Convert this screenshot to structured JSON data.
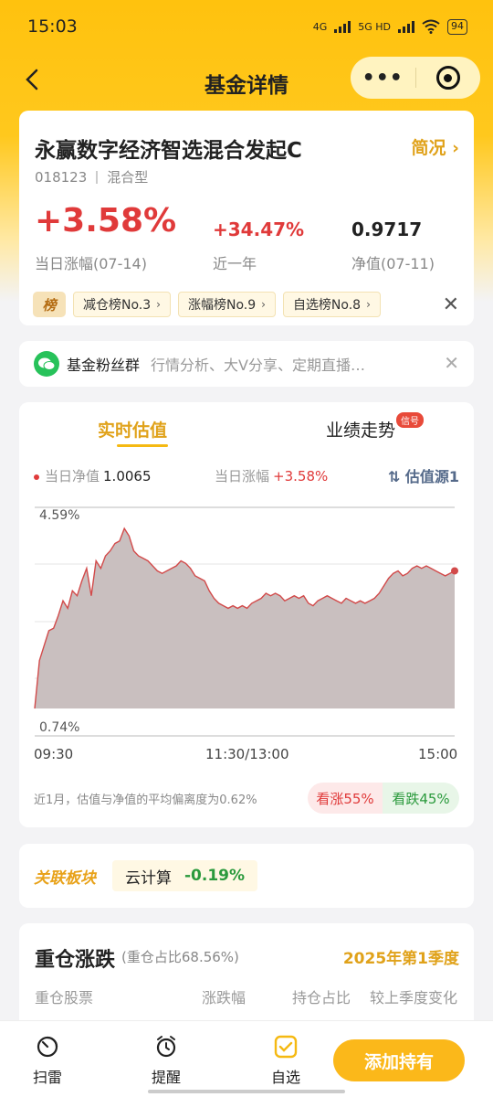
{
  "status_bar": {
    "time": "15:03",
    "net1": "4G",
    "net2": "5G HD",
    "battery": "94"
  },
  "nav": {
    "title": "基金详情",
    "more_label": "•••"
  },
  "fund": {
    "name": "永赢数字经济智选混合发起C",
    "overview_label": "简况 ›",
    "code": "018123",
    "type": "混合型",
    "day_change": "+3.58%",
    "day_change_label": "当日涨幅(07-14)",
    "year_change": "+34.47%",
    "year_change_label": "近一年",
    "nav_value": "0.9717",
    "nav_label": "净值(07-11)",
    "rank_badge": "榜",
    "tags": [
      "减仓榜No.3",
      "涨幅榜No.9",
      "自选榜No.8"
    ],
    "tag_chevron": "›",
    "close_label": "✕"
  },
  "fans": {
    "name": "基金粉丝群",
    "desc": "行情分析、大V分享、定期直播…",
    "close_label": "✕"
  },
  "chart_section": {
    "tab_realtime": "实时估值",
    "tab_performance": "业绩走势",
    "badge": "信号",
    "est_nav_label": "当日净值",
    "est_nav_value": "1.0065",
    "est_change_label": "当日涨幅",
    "est_change_value": "+3.58%",
    "source_label": "⇅ 估值源1",
    "time_start": "09:30",
    "time_mid": "11:30/13:00",
    "time_end": "15:00",
    "deviation_note": "近1月，估值与净值的平均偏离度为0.62%",
    "vote_up": "看涨55%",
    "vote_down": "看跌45%"
  },
  "chart_data": {
    "type": "area",
    "ylim": [
      0.74,
      4.59
    ],
    "ytick_labels": [
      "4.59%",
      "0.74%"
    ],
    "xtick_labels": [
      "09:30",
      "11:30/13:00",
      "15:00"
    ],
    "color": "#d24a4a",
    "fill": "#c9bfbf",
    "grid": true,
    "values": [
      0.74,
      1.7,
      2.0,
      2.3,
      2.35,
      2.6,
      2.9,
      2.75,
      3.1,
      3.0,
      3.3,
      3.55,
      3.0,
      3.7,
      3.55,
      3.8,
      3.9,
      4.05,
      4.1,
      4.35,
      4.2,
      3.9,
      3.8,
      3.75,
      3.7,
      3.6,
      3.5,
      3.45,
      3.5,
      3.55,
      3.6,
      3.7,
      3.65,
      3.55,
      3.4,
      3.35,
      3.3,
      3.1,
      2.95,
      2.85,
      2.8,
      2.75,
      2.8,
      2.75,
      2.8,
      2.75,
      2.85,
      2.9,
      2.95,
      3.05,
      3.0,
      3.05,
      3.0,
      2.9,
      2.95,
      3.0,
      2.95,
      3.0,
      2.85,
      2.8,
      2.9,
      2.95,
      3.0,
      2.95,
      2.9,
      2.85,
      2.95,
      2.9,
      2.85,
      2.9,
      2.85,
      2.9,
      2.95,
      3.05,
      3.2,
      3.35,
      3.45,
      3.5,
      3.4,
      3.45,
      3.55,
      3.6,
      3.55,
      3.6,
      3.55,
      3.5,
      3.45,
      3.4,
      3.45,
      3.5
    ]
  },
  "sector": {
    "logo": "关联板块",
    "name": "云计算",
    "change": "-0.19%"
  },
  "holdings": {
    "title": "重仓涨跌",
    "ratio": "(重仓占比68.56%)",
    "quarter": "2025年第1季度",
    "columns": [
      "重仓股票",
      "涨跌幅",
      "持仓占比",
      "较上季度变化"
    ]
  },
  "bottom_bar": {
    "scan": "扫雷",
    "remind": "提醒",
    "watch": "自选",
    "add": "添加持有"
  }
}
